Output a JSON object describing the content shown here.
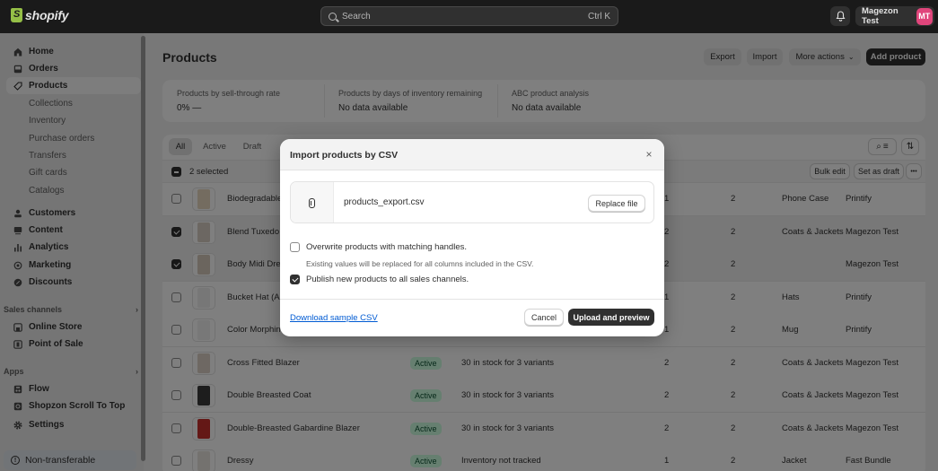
{
  "topbar": {
    "brand": "shopify",
    "search_placeholder": "Search",
    "search_shortcut": "Ctrl K",
    "bell_icon": "bell-icon",
    "user_name": "Magezon Test",
    "user_initials": "MT",
    "avatar_color": "#e0457b"
  },
  "sidebar": {
    "items": [
      {
        "label": "Home",
        "icon": "home-icon"
      },
      {
        "label": "Orders",
        "icon": "inbox-icon"
      },
      {
        "label": "Products",
        "icon": "tag-icon",
        "active": true
      }
    ],
    "product_subitems": [
      "Collections",
      "Inventory",
      "Purchase orders",
      "Transfers",
      "Gift cards",
      "Catalogs"
    ],
    "items2": [
      {
        "label": "Customers",
        "icon": "person-icon"
      },
      {
        "label": "Content",
        "icon": "image-icon"
      },
      {
        "label": "Analytics",
        "icon": "bar-chart-icon"
      },
      {
        "label": "Marketing",
        "icon": "target-icon"
      },
      {
        "label": "Discounts",
        "icon": "discount-icon"
      }
    ],
    "sales_channels_label": "Sales channels",
    "sales_channels": [
      {
        "label": "Online Store",
        "icon": "store-icon"
      },
      {
        "label": "Point of Sale",
        "icon": "pos-icon"
      }
    ],
    "apps_label": "Apps",
    "apps": [
      {
        "label": "Flow",
        "icon": "flow-icon"
      },
      {
        "label": "Shopzon Scroll To Top",
        "icon": "app-icon"
      }
    ],
    "settings_label": "Settings",
    "footer_badge": "Non-transferable"
  },
  "main": {
    "title": "Products",
    "header_buttons": {
      "export": "Export",
      "import": "Import",
      "more_actions": "More actions",
      "add_product": "Add product"
    },
    "metrics": [
      {
        "label": "Products by sell-through rate",
        "value": "0%  —"
      },
      {
        "label": "Products by days of inventory remaining",
        "value": "No data available"
      },
      {
        "label": "ABC product analysis",
        "value": "No data available"
      }
    ],
    "tabs": [
      "All",
      "Active",
      "Draft"
    ],
    "active_tab": "All",
    "selected_count_text": "2 selected",
    "bulk_actions": {
      "bulk_edit": "Bulk edit",
      "set_as_draft": "Set as draft",
      "more": "•••"
    },
    "rows": [
      {
        "name": "Biodegradable",
        "status": "",
        "inventory": "",
        "c1": "1",
        "c2": "2",
        "category": "Phone Case",
        "vendor": "Printify",
        "checked": false,
        "thumb_color": "#e8d9c0"
      },
      {
        "name": "Blend Tuxedo",
        "status": "",
        "inventory": "",
        "c1": "2",
        "c2": "2",
        "category": "Coats & Jackets",
        "vendor": "Magezon Test",
        "checked": true,
        "thumb_color": "#d9cfc4"
      },
      {
        "name": "Body Midi Dre",
        "status": "",
        "inventory": "",
        "c1": "2",
        "c2": "2",
        "category": "",
        "vendor": "Magezon Test",
        "checked": true,
        "thumb_color": "#d6cabc"
      },
      {
        "name": "Bucket Hat (A",
        "status": "",
        "inventory": "",
        "c1": "1",
        "c2": "2",
        "category": "Hats",
        "vendor": "Printify",
        "checked": false,
        "thumb_color": "#eeeeee"
      },
      {
        "name": "Color Morphin",
        "status": "",
        "inventory": "",
        "c1": "1",
        "c2": "2",
        "category": "Mug",
        "vendor": "Printify",
        "checked": false,
        "thumb_color": "#f1f1f1"
      },
      {
        "name": "Cross Fitted Blazer",
        "status": "Active",
        "inventory": "30 in stock for 3 variants",
        "c1": "2",
        "c2": "2",
        "category": "Coats & Jackets",
        "vendor": "Magezon Test",
        "checked": false,
        "thumb_color": "#ddd0c6"
      },
      {
        "name": "Double Breasted Coat",
        "status": "Active",
        "inventory": "30 in stock for 3 variants",
        "c1": "2",
        "c2": "2",
        "category": "Coats & Jackets",
        "vendor": "Magezon Test",
        "checked": false,
        "thumb_color": "#3a3a3a"
      },
      {
        "name": "Double-Breasted Gabardine Blazer",
        "status": "Active",
        "inventory": "30 in stock for 3 variants",
        "c1": "2",
        "c2": "2",
        "category": "Coats & Jackets",
        "vendor": "Magezon Test",
        "checked": false,
        "thumb_color": "#c9302c"
      },
      {
        "name": "Dressy",
        "status": "Active",
        "inventory": "Inventory not tracked",
        "c1": "1",
        "c2": "2",
        "category": "Jacket",
        "vendor": "Fast Bundle",
        "checked": false,
        "thumb_color": "#e9e4de"
      }
    ]
  },
  "modal": {
    "title": "Import products by CSV",
    "close_label": "×",
    "file_name": "products_export.csv",
    "replace_file": "Replace file",
    "option_overwrite": "Overwrite products with matching handles.",
    "option_overwrite_checked": false,
    "option_overwrite_help": "Existing values will be replaced for all columns included in the CSV.",
    "option_publish": "Publish new products to all sales channels.",
    "option_publish_checked": true,
    "download_link": "Download sample CSV",
    "cancel": "Cancel",
    "upload": "Upload and preview"
  }
}
